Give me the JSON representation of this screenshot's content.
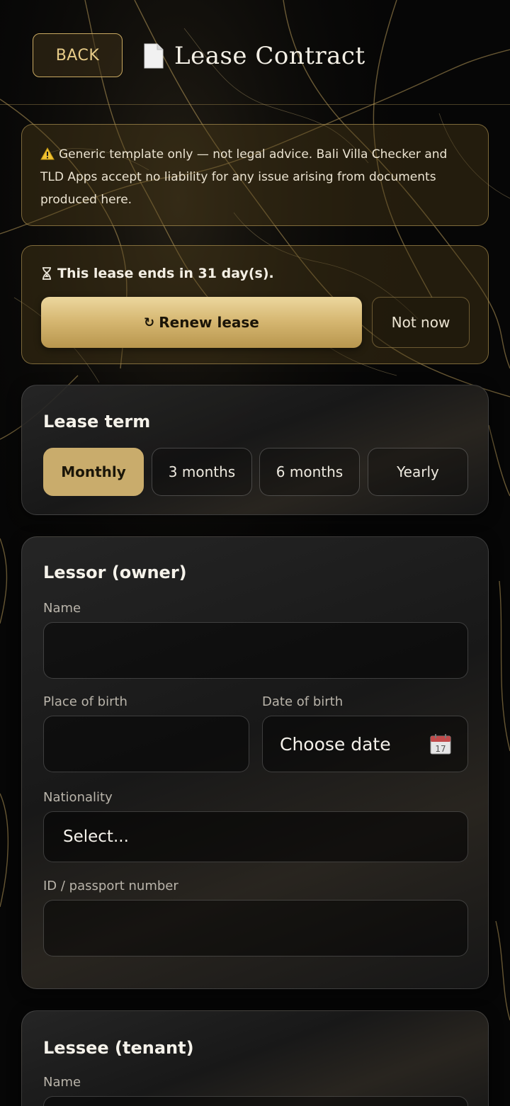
{
  "header": {
    "back_label": "BACK",
    "title": "Lease Contract",
    "title_icon": "document-icon"
  },
  "disclaimer": {
    "icon": "warning-icon",
    "text": "Generic template only — not legal advice. Bali Villa Checker and TLD Apps accept no liability for any issue arising from documents produced here."
  },
  "expiry": {
    "icon": "hourglass-icon",
    "text": "This lease ends in 31 day(s).",
    "renew_label": "Renew lease",
    "renew_icon": "renew-icon",
    "not_now_label": "Not now"
  },
  "lease_term": {
    "title": "Lease term",
    "options": [
      "Monthly",
      "3 months",
      "6 months",
      "Yearly"
    ],
    "selected": "Monthly"
  },
  "lessor": {
    "title": "Lessor (owner)",
    "name_label": "Name",
    "name_value": "",
    "birthplace_label": "Place of birth",
    "birthplace_value": "",
    "dob_label": "Date of birth",
    "dob_placeholder": "Choose date",
    "dob_icon": "calendar-icon",
    "nationality_label": "Nationality",
    "nationality_value": "Select...",
    "id_label": "ID / passport number",
    "id_value": ""
  },
  "lessee": {
    "title": "Lessee (tenant)",
    "name_label": "Name"
  },
  "colors": {
    "accent_gold": "#c9ac6c",
    "background": "#050505"
  }
}
